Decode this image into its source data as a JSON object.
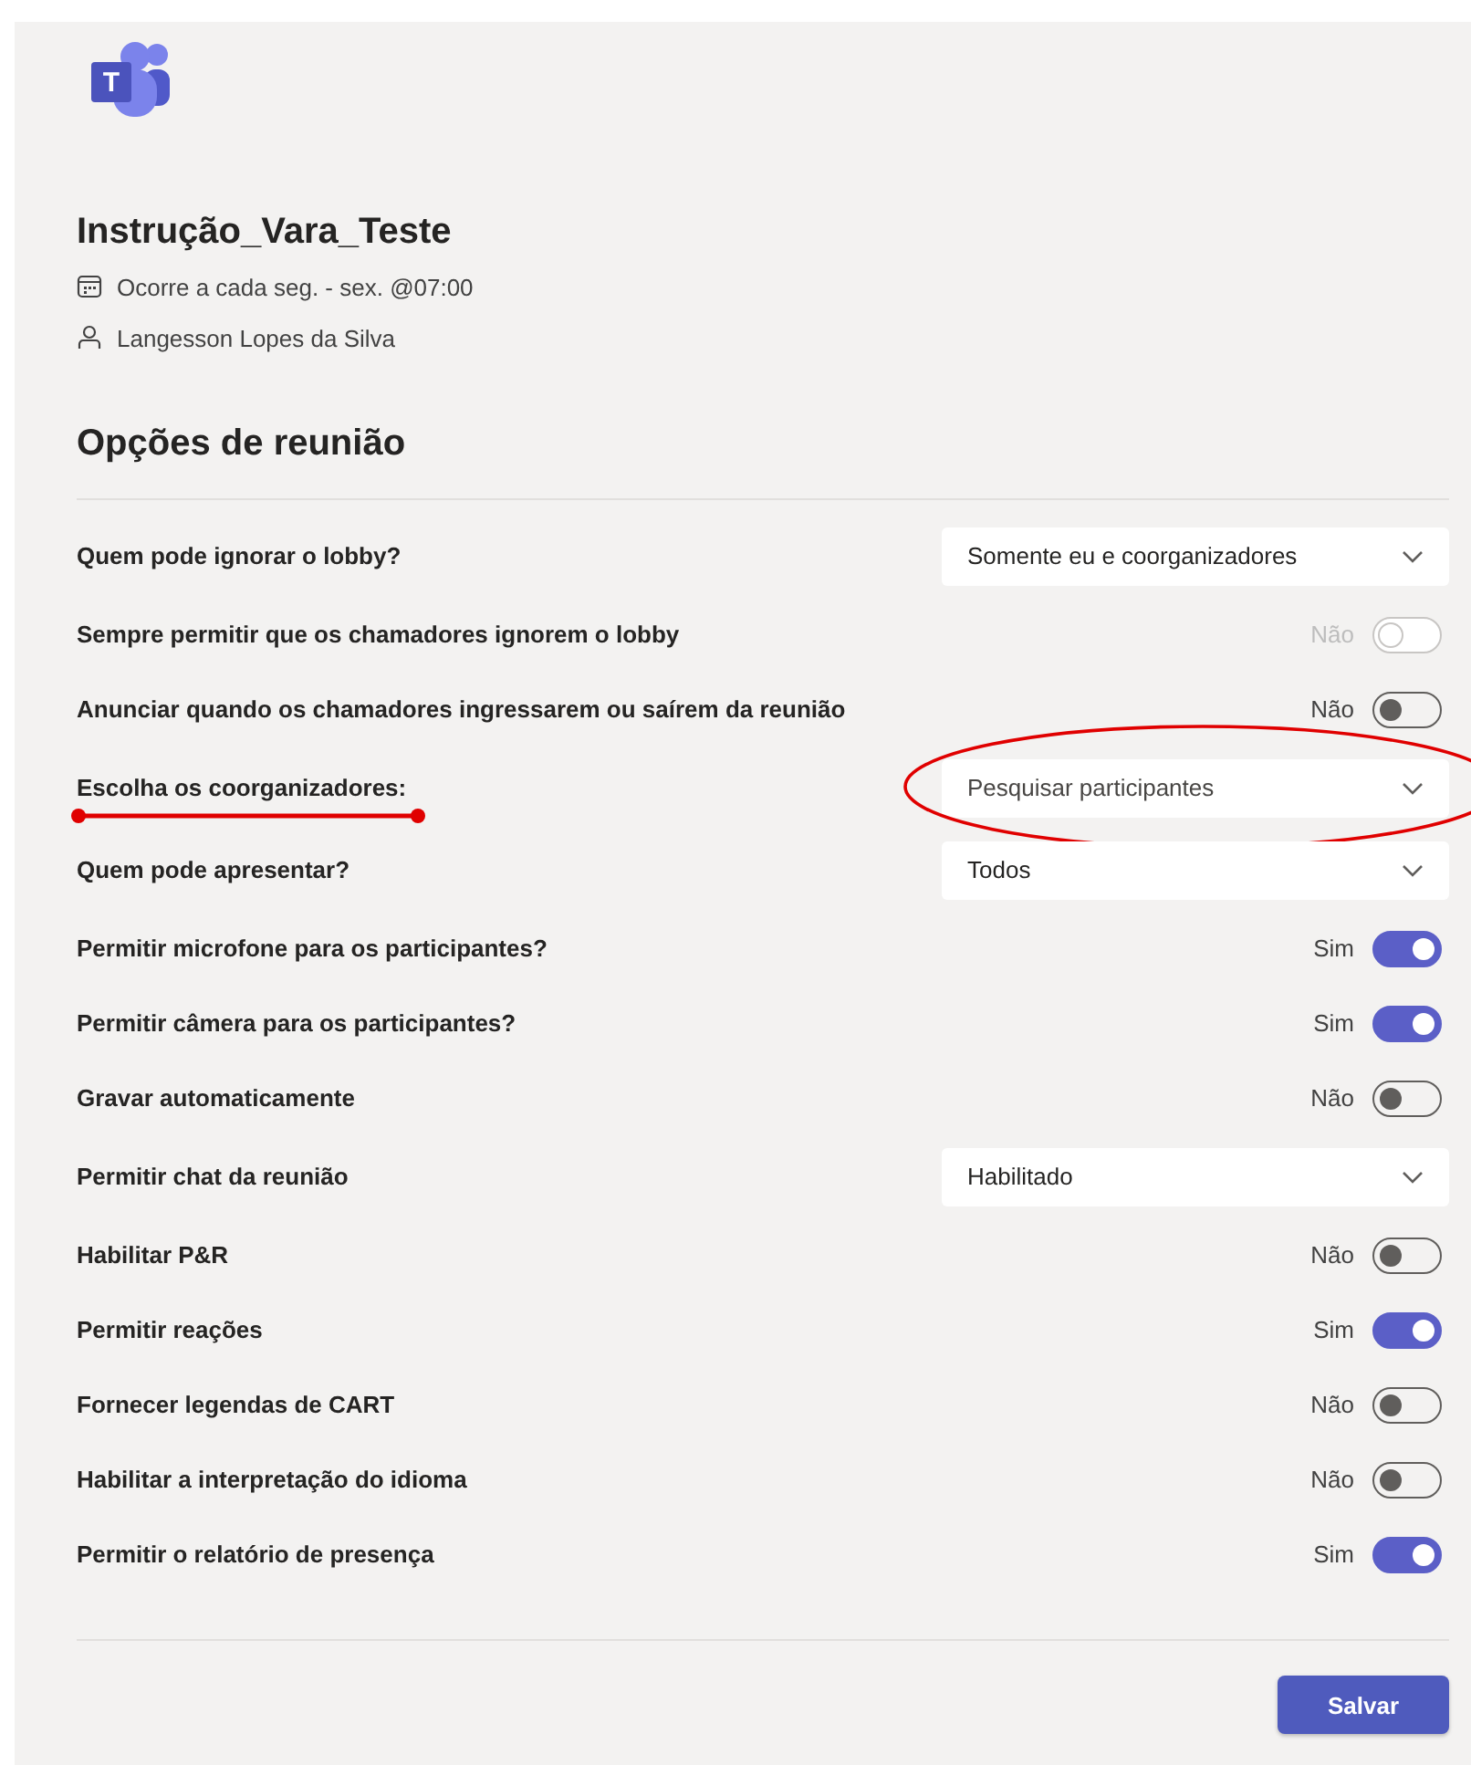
{
  "logo": {
    "letter": "T"
  },
  "meeting": {
    "title": "Instrução_Vara_Teste",
    "recurrence": "Ocorre a cada seg. - sex. @07:00",
    "organizer": "Langesson Lopes da Silva"
  },
  "section_title": "Opções de reunião",
  "options": [
    {
      "kind": "dropdown",
      "label": "Quem pode ignorar o lobby?",
      "value": "Somente eu e coorganizadores"
    },
    {
      "kind": "toggle",
      "label": "Sempre permitir que os chamadores ignorem o lobby",
      "state_text": "Não",
      "on": false,
      "disabled": true
    },
    {
      "kind": "toggle",
      "label": "Anunciar quando os chamadores ingressarem ou saírem da reunião",
      "state_text": "Não",
      "on": false,
      "disabled": false
    },
    {
      "kind": "dropdown",
      "label": "Escolha os coorganizadores:",
      "placeholder": "Pesquisar participantes",
      "annotated": true
    },
    {
      "kind": "dropdown",
      "label": "Quem pode apresentar?",
      "value": "Todos"
    },
    {
      "kind": "toggle",
      "label": "Permitir microfone para os participantes?",
      "state_text": "Sim",
      "on": true,
      "disabled": false
    },
    {
      "kind": "toggle",
      "label": "Permitir câmera para os participantes?",
      "state_text": "Sim",
      "on": true,
      "disabled": false
    },
    {
      "kind": "toggle",
      "label": "Gravar automaticamente",
      "state_text": "Não",
      "on": false,
      "disabled": false
    },
    {
      "kind": "dropdown",
      "label": "Permitir chat da reunião",
      "value": "Habilitado"
    },
    {
      "kind": "toggle",
      "label": "Habilitar P&R",
      "state_text": "Não",
      "on": false,
      "disabled": false
    },
    {
      "kind": "toggle",
      "label": "Permitir reações",
      "state_text": "Sim",
      "on": true,
      "disabled": false
    },
    {
      "kind": "toggle",
      "label": "Fornecer legendas de CART",
      "state_text": "Não",
      "on": false,
      "disabled": false
    },
    {
      "kind": "toggle",
      "label": "Habilitar a interpretação do idioma",
      "state_text": "Não",
      "on": false,
      "disabled": false
    },
    {
      "kind": "toggle",
      "label": "Permitir o relatório de presença",
      "state_text": "Sim",
      "on": true,
      "disabled": false
    }
  ],
  "save_button": "Salvar"
}
